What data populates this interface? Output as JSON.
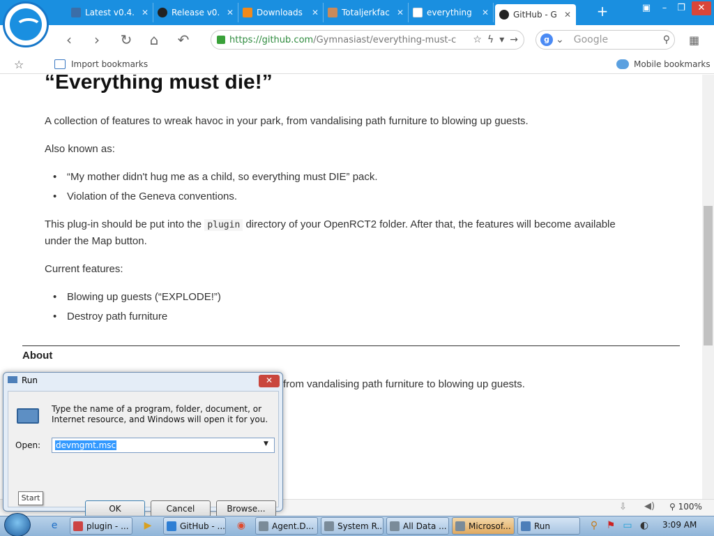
{
  "browser": {
    "tabs": [
      {
        "label": "Latest v0.4.",
        "icon": "tool-icon"
      },
      {
        "label": "Release v0.",
        "icon": "github-icon"
      },
      {
        "label": "Downloads",
        "icon": "download-icon"
      },
      {
        "label": "Totaljerkfac",
        "icon": "face-icon"
      },
      {
        "label": "everything",
        "icon": "document-icon"
      },
      {
        "label": "GitHub - G",
        "icon": "github-icon"
      }
    ],
    "tab_close": "✕",
    "new_tab": "+",
    "url_host": "https://github.com",
    "url_path": "/Gymnasiast/everything-must-c",
    "search_placeholder": "Google",
    "search_engine_letter": "g",
    "bookmarks": {
      "import": "Import bookmarks",
      "mobile": "Mobile bookmarks"
    },
    "zoom": "100%"
  },
  "page": {
    "heading": "“Everything must die!”",
    "intro": "A collection of features to wreak havoc in your park, from vandalising path furniture to blowing up guests.",
    "aka_label": "Also known as:",
    "aka": [
      "“My mother didn't hug me as a child, so everything must DIE” pack.",
      "Violation of the Geneva conventions."
    ],
    "install_before": "This plug-in should be put into the ",
    "install_code": "plugin",
    "install_after": " directory of your OpenRCT2 folder. After that, the features will become available",
    "install_line2": "under the Map button.",
    "features_label": "Current features:",
    "features": [
      "Blowing up guests (“EXPLODE!”)",
      "Destroy path furniture"
    ],
    "about_heading": "About",
    "about_text_visible": "from vandalising path furniture to blowing up guests."
  },
  "run_dialog": {
    "title": "Run",
    "description": "Type the name of a program, folder, document, or Internet resource, and Windows will open it for you.",
    "open_label": "Open:",
    "value": "devmgmt.msc",
    "ok": "OK",
    "cancel": "Cancel",
    "browse": "Browse..."
  },
  "start_tooltip": "Start",
  "taskbar": {
    "items": [
      {
        "label": "plugin - ...",
        "icon": "record-icon"
      },
      {
        "label": "GitHub - ...",
        "icon": "browser-icon"
      },
      {
        "label": "Agent.D...",
        "icon": "window-icon"
      },
      {
        "label": "System R...",
        "icon": "window-icon"
      },
      {
        "label": "All Data ...",
        "icon": "window-icon"
      },
      {
        "label": "Microsof...",
        "icon": "window-icon"
      },
      {
        "label": "Run",
        "icon": "run-icon"
      }
    ],
    "clock": "3:09 AM"
  }
}
